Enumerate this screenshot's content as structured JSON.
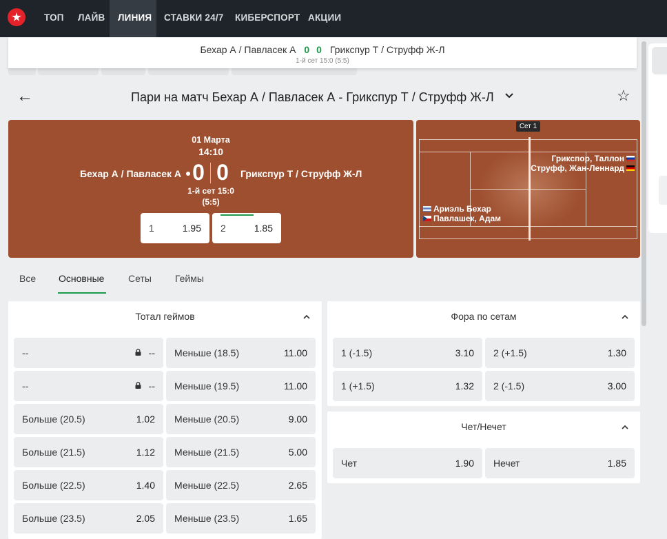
{
  "nav": {
    "items": [
      {
        "label": "ТОП"
      },
      {
        "label": "ЛАЙВ"
      },
      {
        "label": "ЛИНИЯ",
        "active": true
      },
      {
        "label": "СТАВКИ 24/7"
      },
      {
        "label": "КИБЕРСПОРТ"
      },
      {
        "label": "АКЦИИ"
      }
    ],
    "logo_icon": "soccer-ball-icon"
  },
  "sticky": {
    "team1": "Бехар А / Павласек А",
    "score1": "0",
    "score2": "0",
    "team2": "Грикспур Т / Струфф Ж-Л",
    "status": "1-й сет 15:0 (5:5)"
  },
  "header": {
    "back_icon": "arrow-left-icon",
    "title": "Пари на матч Бехар А / Павласек А - Грикспур Т / Струфф Ж-Л",
    "dropdown_icon": "chevron-down-icon",
    "favorite_icon": "star-icon"
  },
  "scoreboard": {
    "date": "01 Марта",
    "time": "14:10",
    "team1": "Бехар А / Павласек А",
    "score1": "0",
    "score2": "0",
    "team2": "Грикспур Т / Струфф Ж-Л",
    "set_status": "1-й сет 15:0",
    "games": "(5:5)",
    "odds": [
      {
        "label": "1",
        "value": "1.95"
      },
      {
        "label": "2",
        "value": "1.85"
      }
    ],
    "bg_color": "#9e4f2f"
  },
  "court": {
    "set_badge": "Сет 1",
    "team2_players": [
      {
        "name": "Грикспор, Таллон",
        "flag": "netherlands-flag-icon"
      },
      {
        "name": "Струфф, Жан-Леннард",
        "flag": "germany-flag-icon"
      }
    ],
    "team1_players": [
      {
        "name": "Ариэль Бехар",
        "flag": "uruguay-flag-icon"
      },
      {
        "name": "Павлашек, Адам",
        "flag": "czech-flag-icon"
      }
    ]
  },
  "tabs": [
    {
      "label": "Все"
    },
    {
      "label": "Основные",
      "active": true
    },
    {
      "label": "Сеты"
    },
    {
      "label": "Геймы"
    }
  ],
  "accent_color": "#1a9a4a",
  "markets": {
    "total_games": {
      "title": "Тотал геймов",
      "rows": [
        [
          {
            "label": "--",
            "value": "--",
            "locked": true
          },
          {
            "label": "Меньше (18.5)",
            "value": "11.00"
          }
        ],
        [
          {
            "label": "--",
            "value": "--",
            "locked": true
          },
          {
            "label": "Меньше (19.5)",
            "value": "11.00"
          }
        ],
        [
          {
            "label": "Больше (20.5)",
            "value": "1.02"
          },
          {
            "label": "Меньше (20.5)",
            "value": "9.00"
          }
        ],
        [
          {
            "label": "Больше (21.5)",
            "value": "1.12"
          },
          {
            "label": "Меньше (21.5)",
            "value": "5.00"
          }
        ],
        [
          {
            "label": "Больше (22.5)",
            "value": "1.40"
          },
          {
            "label": "Меньше (22.5)",
            "value": "2.65"
          }
        ],
        [
          {
            "label": "Больше (23.5)",
            "value": "2.05"
          },
          {
            "label": "Меньше (23.5)",
            "value": "1.65"
          }
        ]
      ]
    },
    "set_handicap": {
      "title": "Фора по сетам",
      "rows": [
        [
          {
            "label": "1 (-1.5)",
            "value": "3.10"
          },
          {
            "label": "2 (+1.5)",
            "value": "1.30"
          }
        ],
        [
          {
            "label": "1 (+1.5)",
            "value": "1.32"
          },
          {
            "label": "2 (-1.5)",
            "value": "3.00"
          }
        ]
      ]
    },
    "odd_even": {
      "title": "Чет/Нечет",
      "rows": [
        [
          {
            "label": "Чет",
            "value": "1.90"
          },
          {
            "label": "Нечет",
            "value": "1.85"
          }
        ]
      ]
    }
  }
}
